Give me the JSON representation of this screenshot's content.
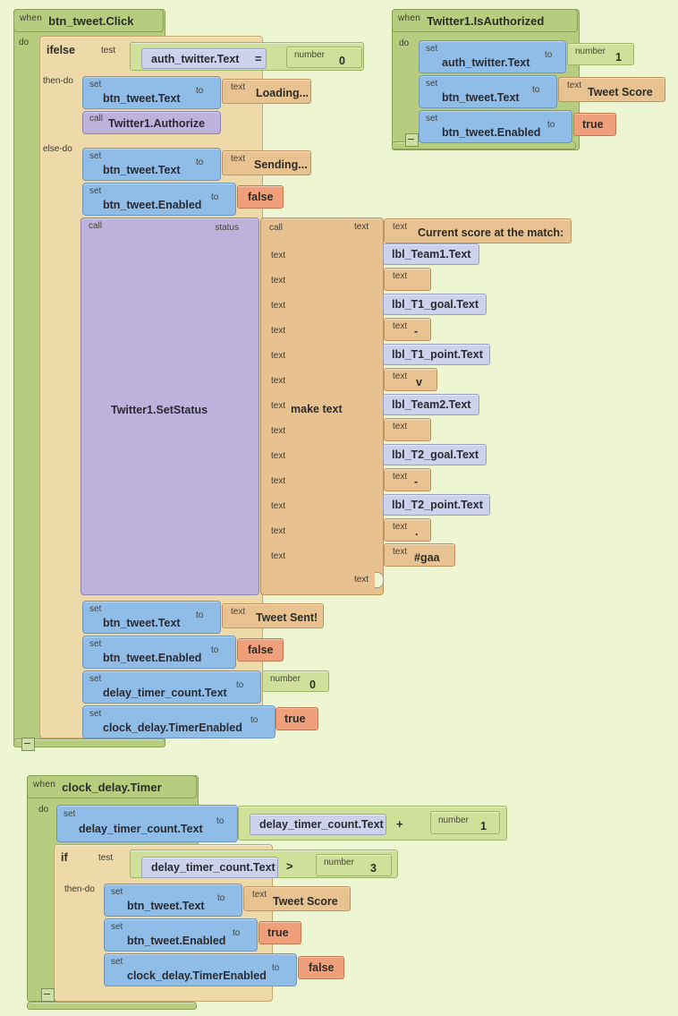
{
  "workspace": {
    "background_color": "#edf5d3",
    "keywords": {
      "when": "when",
      "do": "do",
      "test": "test",
      "then_do": "then-do",
      "else_do": "else-do",
      "set": "set",
      "to": "to",
      "call": "call",
      "text": "text",
      "number": "number",
      "status": "status",
      "ifelse": "ifelse",
      "if": "if",
      "make_text": "make text"
    },
    "colors": {
      "event": "#b6cc7e",
      "control": "#eed9a9",
      "setter": "#8fbde8",
      "getter": "#ccd2ec",
      "call": "#bcb2dc",
      "text_literal": "#e8c291",
      "math": "#cfe09a",
      "boolean": "#efa07a"
    }
  },
  "blocks": {
    "event1": {
      "name": "btn_tweet.Click",
      "ifelse": {
        "test_left": "auth_twitter.Text",
        "test_op": "=",
        "test_right": "0",
        "then": [
          {
            "set": "btn_tweet.Text",
            "value": "Loading..."
          },
          {
            "call": "Twitter1.Authorize"
          }
        ],
        "else": [
          {
            "set": "btn_tweet.Text",
            "value": "Sending..."
          },
          {
            "set": "btn_tweet.Enabled",
            "value": "false"
          },
          {
            "call": "Twitter1.SetStatus"
          },
          {
            "set": "btn_tweet.Text",
            "value": "Tweet Sent!"
          },
          {
            "set": "btn_tweet.Enabled",
            "value": "false"
          },
          {
            "set": "delay_timer_count.Text",
            "value": "0"
          },
          {
            "set": "clock_delay.TimerEnabled",
            "value": "true"
          }
        ]
      },
      "make_text_items": [
        {
          "kind": "text",
          "value": "Current score at the match:"
        },
        {
          "kind": "getter",
          "value": "lbl_Team1.Text"
        },
        {
          "kind": "text",
          "value": " "
        },
        {
          "kind": "getter",
          "value": "lbl_T1_goal.Text"
        },
        {
          "kind": "text",
          "value": "-"
        },
        {
          "kind": "getter",
          "value": "lbl_T1_point.Text"
        },
        {
          "kind": "text",
          "value": "v"
        },
        {
          "kind": "getter",
          "value": "lbl_Team2.Text"
        },
        {
          "kind": "text",
          "value": " "
        },
        {
          "kind": "getter",
          "value": "lbl_T2_goal.Text"
        },
        {
          "kind": "text",
          "value": "-"
        },
        {
          "kind": "getter",
          "value": "lbl_T2_point.Text"
        },
        {
          "kind": "text",
          "value": "."
        },
        {
          "kind": "text",
          "value": "#gaa"
        },
        {
          "kind": "empty",
          "value": ""
        }
      ]
    },
    "event2": {
      "name": "Twitter1.IsAuthorized",
      "statements": [
        {
          "set": "auth_twitter.Text",
          "kw": "number",
          "value": "1"
        },
        {
          "set": "btn_tweet.Text",
          "kw": "text",
          "value": "Tweet Score"
        },
        {
          "set": "btn_tweet.Enabled",
          "kw": "bool",
          "value": "true"
        }
      ]
    },
    "event3": {
      "name": "clock_delay.Timer",
      "increment": {
        "set": "delay_timer_count.Text",
        "left": "delay_timer_count.Text",
        "op": "+",
        "right": "1"
      },
      "if": {
        "test_left": "delay_timer_count.Text",
        "test_op": ">",
        "test_right": "3",
        "then": [
          {
            "set": "btn_tweet.Text",
            "kw": "text",
            "value": "Tweet Score"
          },
          {
            "set": "btn_tweet.Enabled",
            "kw": "bool",
            "value": "true"
          },
          {
            "set": "clock_delay.TimerEnabled",
            "kw": "bool",
            "value": "false"
          }
        ]
      }
    }
  }
}
